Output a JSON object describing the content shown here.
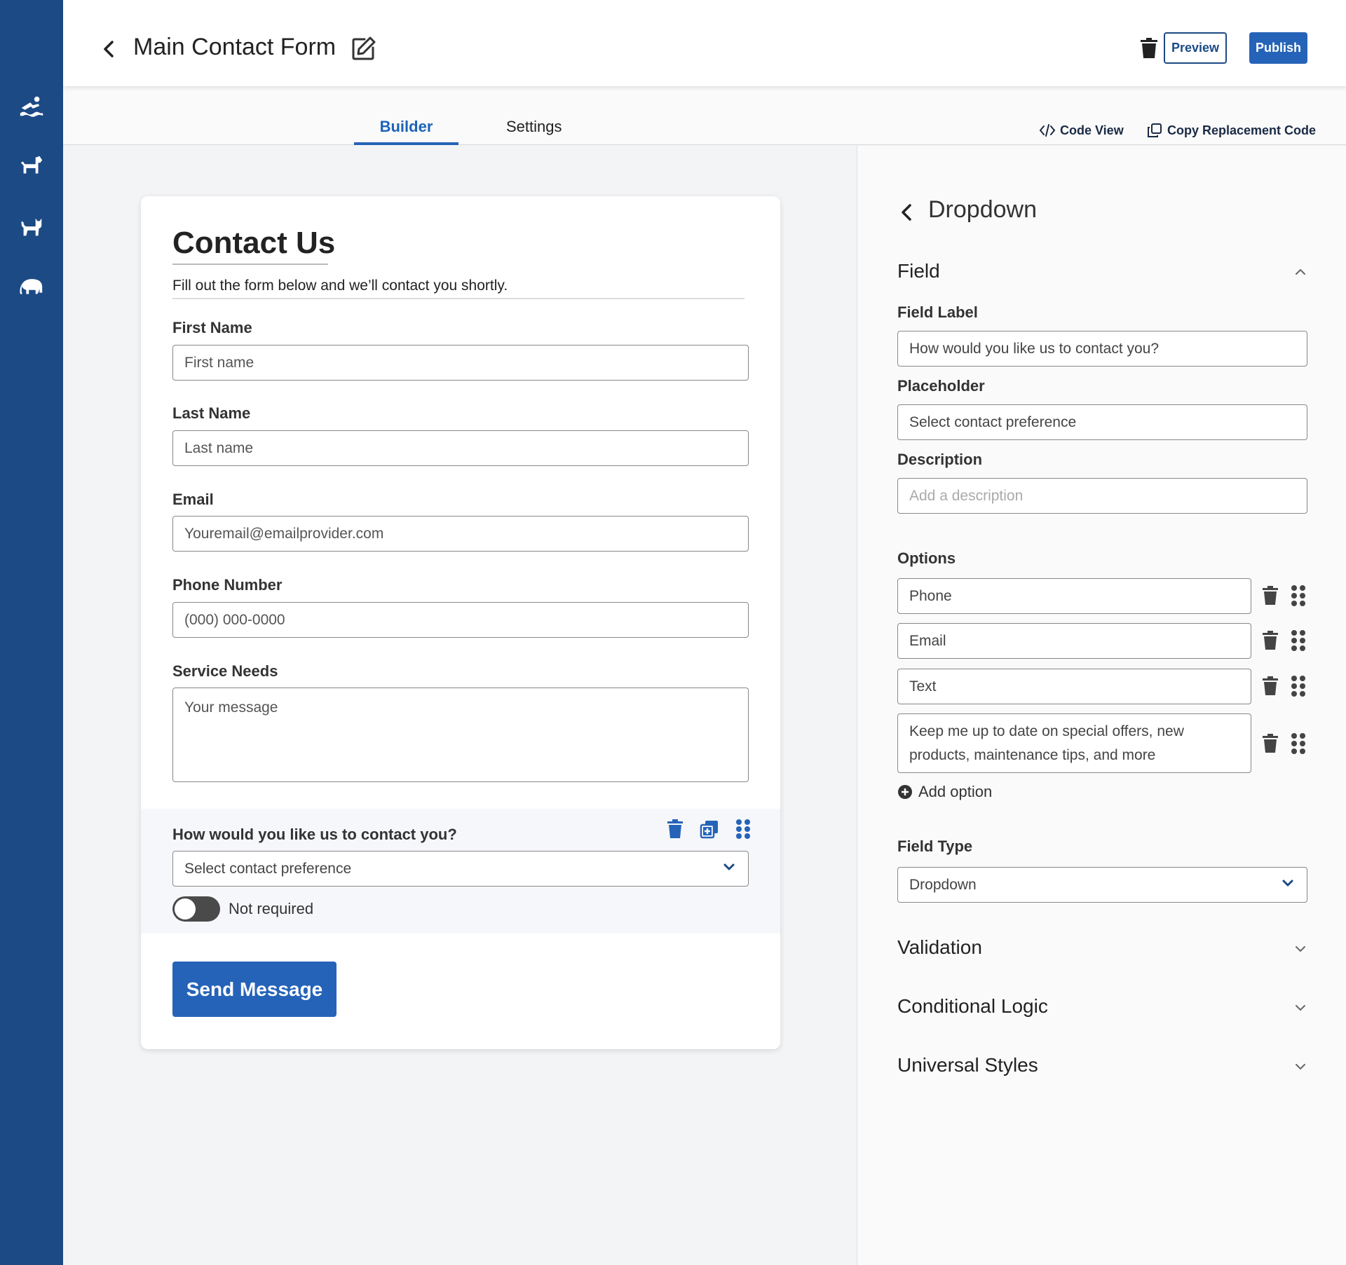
{
  "header": {
    "title": "Main Contact Form",
    "preview_label": "Preview",
    "publish_label": "Publish"
  },
  "sidebar": {
    "items": [
      {
        "icon": "swimmer-icon"
      },
      {
        "icon": "dog-icon"
      },
      {
        "icon": "cat-icon"
      },
      {
        "icon": "elephant-icon"
      }
    ]
  },
  "tabs": [
    {
      "label": "Builder",
      "active": true
    },
    {
      "label": "Settings",
      "active": false
    }
  ],
  "tools": {
    "code_view": "Code View",
    "copy_code": "Copy Replacement Code"
  },
  "form": {
    "title": "Contact Us",
    "subtitle": "Fill out the form below and we’ll contact you shortly.",
    "fields": [
      {
        "label": "First Name",
        "placeholder": "First name"
      },
      {
        "label": "Last Name",
        "placeholder": "Last name"
      },
      {
        "label": "Email",
        "placeholder": "Youremail@emailprovider.com"
      },
      {
        "label": "Phone Number",
        "placeholder": "(000) 000-0000"
      },
      {
        "label": "Service Needs",
        "placeholder": "Your message"
      }
    ],
    "selected_field": {
      "label": "How would you like us to contact you?",
      "placeholder": "Select contact preference",
      "required_label": "Not required",
      "required": false
    },
    "submit_label": "Send Message"
  },
  "panel": {
    "title": "Dropdown",
    "sections": {
      "field": "Field",
      "validation": "Validation",
      "conditional": "Conditional Logic",
      "styles": "Universal Styles"
    },
    "field_label_label": "Field Label",
    "field_label_value": "How would you like us to contact you?",
    "placeholder_label": "Placeholder",
    "placeholder_value": "Select contact preference",
    "description_label": "Description",
    "description_placeholder": "Add a description",
    "options_label": "Options",
    "options": [
      "Phone",
      "Email",
      "Text",
      "Keep me up to date on special offers, new products, maintenance tips, and more"
    ],
    "add_option_label": "Add option",
    "field_type_label": "Field Type",
    "field_type_value": "Dropdown"
  },
  "colors": {
    "brand": "#1c4a85",
    "accent": "#2563b8"
  }
}
